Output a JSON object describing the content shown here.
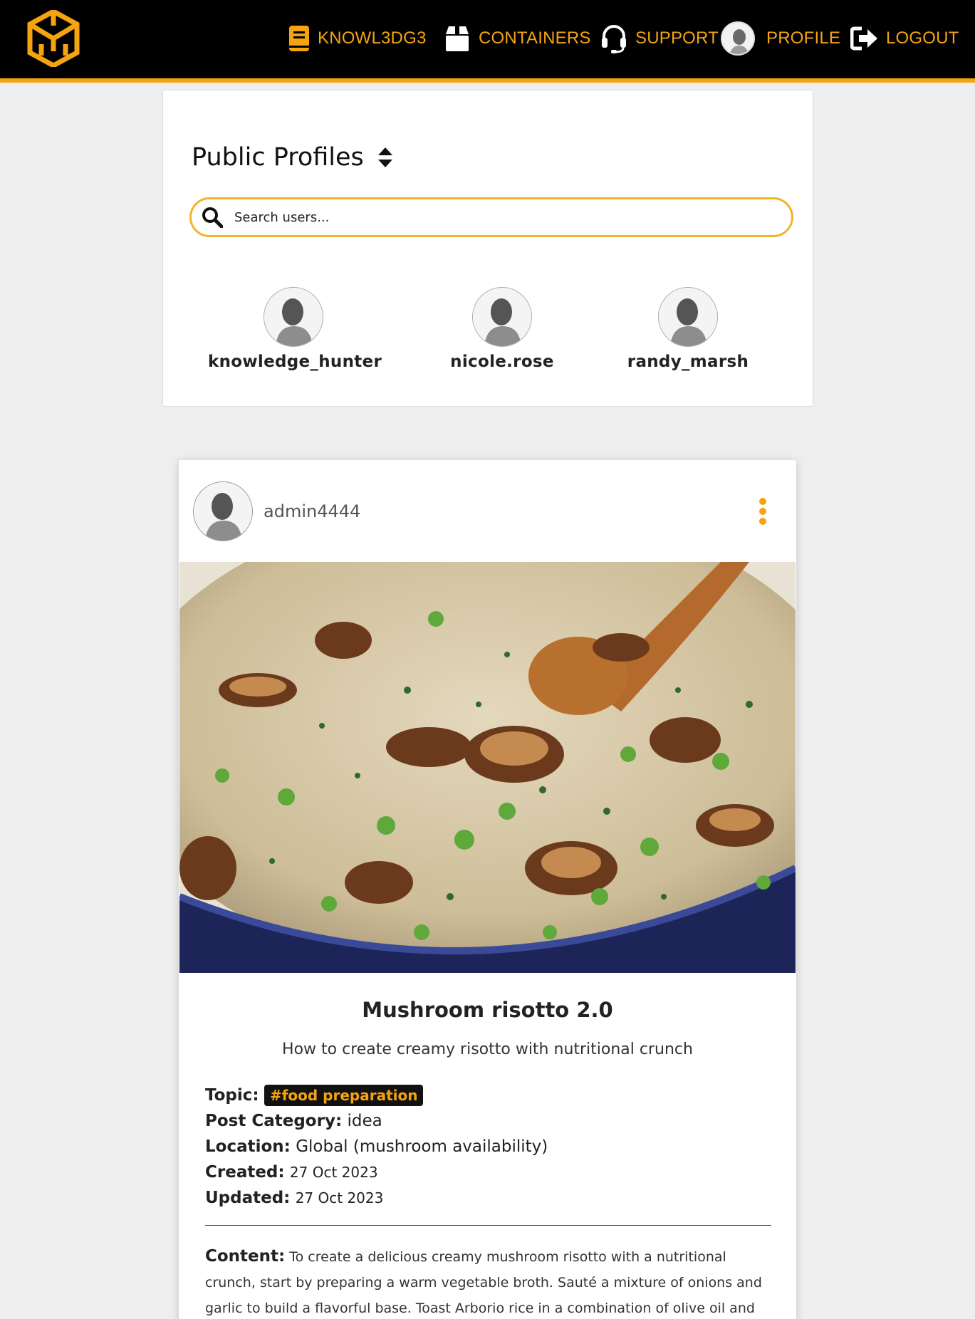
{
  "navbar": {
    "logo_icon": "cube-logo-icon",
    "items": [
      {
        "label": "KNOWL3DG3",
        "icon": "book-icon"
      },
      {
        "label": "CONTAINERS",
        "icon": "box-icon"
      },
      {
        "label": "SUPPORT",
        "icon": "headset-icon"
      },
      {
        "label": "PROFILE",
        "icon": "avatar"
      },
      {
        "label": "LOGOUT",
        "icon": "logout-icon"
      }
    ],
    "accent_color": "#f5a30f",
    "background_color": "#000000"
  },
  "profiles": {
    "title": "Public Profiles",
    "search_placeholder": "Search users...",
    "users": [
      {
        "username": "knowledge_hunter"
      },
      {
        "username": "nicole.rose"
      },
      {
        "username": "randy_marsh"
      }
    ]
  },
  "post": {
    "author": "admin4444",
    "title": "Mushroom risotto 2.0",
    "subtitle": "How to create creamy risotto with nutritional crunch",
    "topic_label": "Topic:",
    "topic_tag": "#food preparation",
    "category_label": "Post Category:",
    "category": "idea",
    "location_label": "Location:",
    "location": "Global (mushroom availability)",
    "created_label": "Created:",
    "created": "27 Oct 2023",
    "updated_label": "Updated:",
    "updated": "27 Oct 2023",
    "content_label": "Content:",
    "content": "To create a delicious creamy mushroom risotto with a nutritional crunch, start by preparing a warm vegetable broth. Sauté a mixture of onions and garlic to build a flavorful base. Toast Arborio rice in a combination of olive oil and butter,"
  }
}
